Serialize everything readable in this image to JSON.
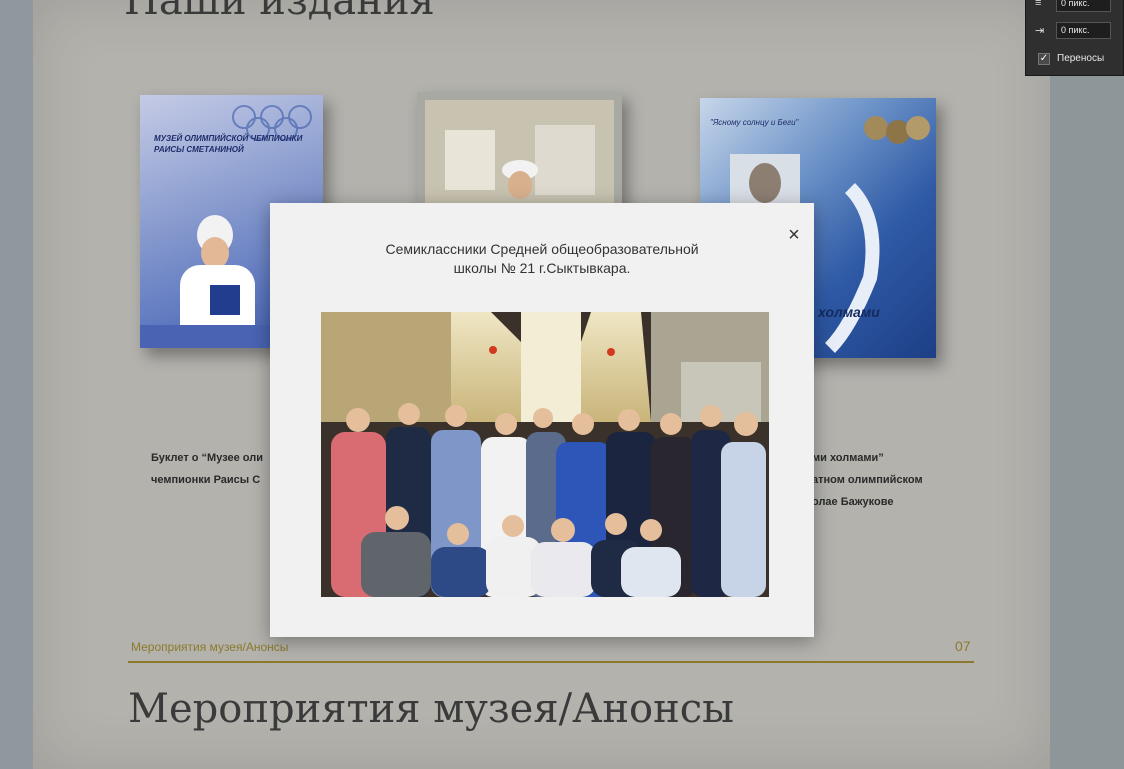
{
  "page": {
    "top_heading": "Наши издания",
    "bottom_heading": "Мероприятия музея/Анонсы",
    "footer_section_label": "Мероприятия музея/Анонсы",
    "footer_page_number": "07"
  },
  "books": [
    {
      "small_text": "МУЗЕЙ ОЛИМПИЙСКОЙ ЧЕМПИОНКИ",
      "title": "МУЗЕЙ ОЛИМПИЙСКОЙ ЧЕМПИОНКИ РАИСЫ СМЕТАНИНОЙ",
      "caption_line1": "Буклет о “Музее оли",
      "caption_line2": "чемпионки Раисы С"
    },
    {},
    {
      "quote": "\"Ясному солнцу и Беги\"",
      "cover_label": "холмами",
      "caption_line1": "ми холмами”",
      "caption_line2": "атном олимпийском",
      "caption_line3": "олае Бажукове"
    }
  ],
  "modal": {
    "caption_line1": "Семиклассники Средней общеобразовательной",
    "caption_line2": "школы № 21 г.Сыктывкара.",
    "close_label": "×"
  },
  "panel": {
    "indent_top_value": "0 пикс.",
    "indent_bottom_value": "0 пикс.",
    "hyphenation_checked": "✓",
    "hyphenation_label": "Переносы"
  }
}
